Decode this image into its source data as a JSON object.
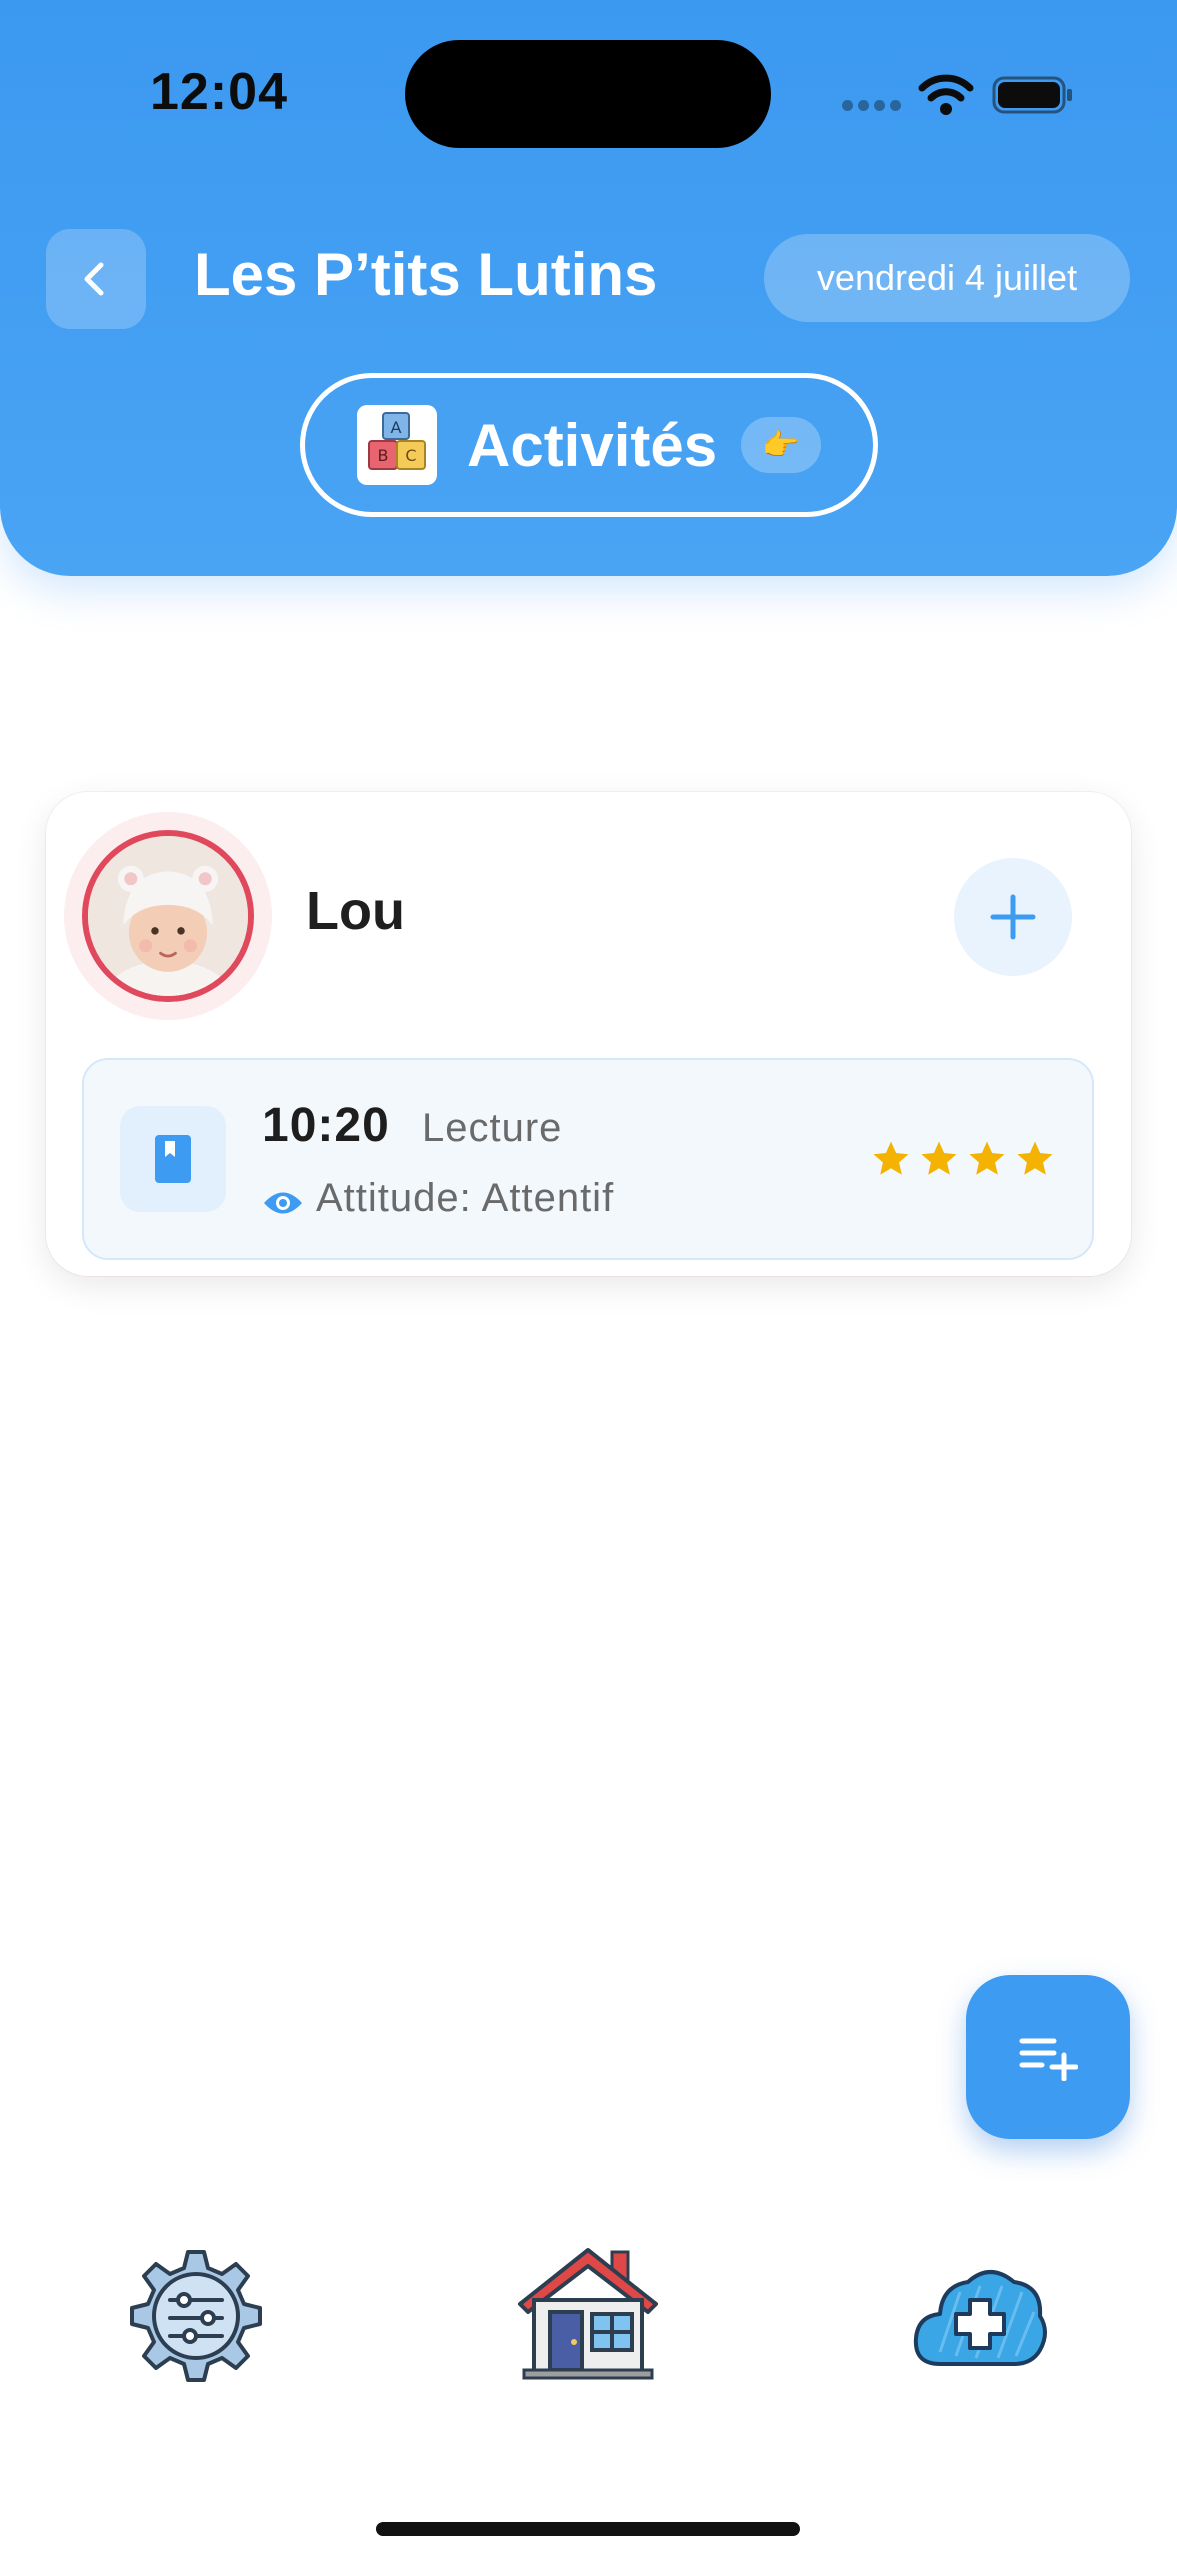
{
  "status_bar": {
    "time": "12:04"
  },
  "header": {
    "title": "Les P’tits Lutins",
    "date": "vendredi 4 juillet",
    "section_label": "Activités",
    "pointing_emoji": "👉",
    "blocks_letters": [
      "A",
      "B",
      "C"
    ]
  },
  "child": {
    "name": "Lou",
    "activities": [
      {
        "time": "10:20",
        "type": "Lecture",
        "attitude": "Attitude: Attentif",
        "rating": 4
      }
    ]
  },
  "nav": {
    "items": [
      {
        "icon": "settings-gear-icon"
      },
      {
        "icon": "home-house-icon"
      },
      {
        "icon": "cloud-plus-icon"
      }
    ]
  },
  "colors": {
    "primary": "#3e9bf2",
    "accent_red": "#e0485c",
    "star": "#f5b301",
    "text_dark": "#1f1f1f",
    "text_muted": "#6a6a6a"
  }
}
